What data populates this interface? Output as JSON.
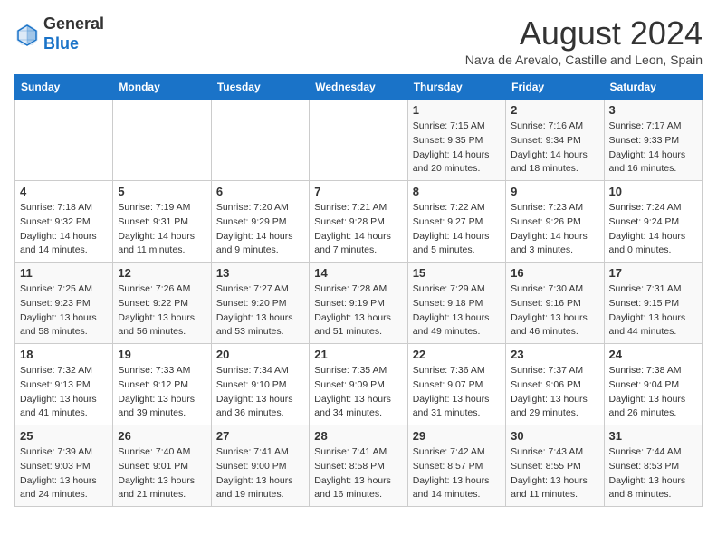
{
  "header": {
    "logo_line1": "General",
    "logo_line2": "Blue",
    "month_year": "August 2024",
    "subtitle": "Nava de Arevalo, Castille and Leon, Spain"
  },
  "weekdays": [
    "Sunday",
    "Monday",
    "Tuesday",
    "Wednesday",
    "Thursday",
    "Friday",
    "Saturday"
  ],
  "weeks": [
    [
      {
        "day": "",
        "detail": ""
      },
      {
        "day": "",
        "detail": ""
      },
      {
        "day": "",
        "detail": ""
      },
      {
        "day": "",
        "detail": ""
      },
      {
        "day": "1",
        "detail": "Sunrise: 7:15 AM\nSunset: 9:35 PM\nDaylight: 14 hours\nand 20 minutes."
      },
      {
        "day": "2",
        "detail": "Sunrise: 7:16 AM\nSunset: 9:34 PM\nDaylight: 14 hours\nand 18 minutes."
      },
      {
        "day": "3",
        "detail": "Sunrise: 7:17 AM\nSunset: 9:33 PM\nDaylight: 14 hours\nand 16 minutes."
      }
    ],
    [
      {
        "day": "4",
        "detail": "Sunrise: 7:18 AM\nSunset: 9:32 PM\nDaylight: 14 hours\nand 14 minutes."
      },
      {
        "day": "5",
        "detail": "Sunrise: 7:19 AM\nSunset: 9:31 PM\nDaylight: 14 hours\nand 11 minutes."
      },
      {
        "day": "6",
        "detail": "Sunrise: 7:20 AM\nSunset: 9:29 PM\nDaylight: 14 hours\nand 9 minutes."
      },
      {
        "day": "7",
        "detail": "Sunrise: 7:21 AM\nSunset: 9:28 PM\nDaylight: 14 hours\nand 7 minutes."
      },
      {
        "day": "8",
        "detail": "Sunrise: 7:22 AM\nSunset: 9:27 PM\nDaylight: 14 hours\nand 5 minutes."
      },
      {
        "day": "9",
        "detail": "Sunrise: 7:23 AM\nSunset: 9:26 PM\nDaylight: 14 hours\nand 3 minutes."
      },
      {
        "day": "10",
        "detail": "Sunrise: 7:24 AM\nSunset: 9:24 PM\nDaylight: 14 hours\nand 0 minutes."
      }
    ],
    [
      {
        "day": "11",
        "detail": "Sunrise: 7:25 AM\nSunset: 9:23 PM\nDaylight: 13 hours\nand 58 minutes."
      },
      {
        "day": "12",
        "detail": "Sunrise: 7:26 AM\nSunset: 9:22 PM\nDaylight: 13 hours\nand 56 minutes."
      },
      {
        "day": "13",
        "detail": "Sunrise: 7:27 AM\nSunset: 9:20 PM\nDaylight: 13 hours\nand 53 minutes."
      },
      {
        "day": "14",
        "detail": "Sunrise: 7:28 AM\nSunset: 9:19 PM\nDaylight: 13 hours\nand 51 minutes."
      },
      {
        "day": "15",
        "detail": "Sunrise: 7:29 AM\nSunset: 9:18 PM\nDaylight: 13 hours\nand 49 minutes."
      },
      {
        "day": "16",
        "detail": "Sunrise: 7:30 AM\nSunset: 9:16 PM\nDaylight: 13 hours\nand 46 minutes."
      },
      {
        "day": "17",
        "detail": "Sunrise: 7:31 AM\nSunset: 9:15 PM\nDaylight: 13 hours\nand 44 minutes."
      }
    ],
    [
      {
        "day": "18",
        "detail": "Sunrise: 7:32 AM\nSunset: 9:13 PM\nDaylight: 13 hours\nand 41 minutes."
      },
      {
        "day": "19",
        "detail": "Sunrise: 7:33 AM\nSunset: 9:12 PM\nDaylight: 13 hours\nand 39 minutes."
      },
      {
        "day": "20",
        "detail": "Sunrise: 7:34 AM\nSunset: 9:10 PM\nDaylight: 13 hours\nand 36 minutes."
      },
      {
        "day": "21",
        "detail": "Sunrise: 7:35 AM\nSunset: 9:09 PM\nDaylight: 13 hours\nand 34 minutes."
      },
      {
        "day": "22",
        "detail": "Sunrise: 7:36 AM\nSunset: 9:07 PM\nDaylight: 13 hours\nand 31 minutes."
      },
      {
        "day": "23",
        "detail": "Sunrise: 7:37 AM\nSunset: 9:06 PM\nDaylight: 13 hours\nand 29 minutes."
      },
      {
        "day": "24",
        "detail": "Sunrise: 7:38 AM\nSunset: 9:04 PM\nDaylight: 13 hours\nand 26 minutes."
      }
    ],
    [
      {
        "day": "25",
        "detail": "Sunrise: 7:39 AM\nSunset: 9:03 PM\nDaylight: 13 hours\nand 24 minutes."
      },
      {
        "day": "26",
        "detail": "Sunrise: 7:40 AM\nSunset: 9:01 PM\nDaylight: 13 hours\nand 21 minutes."
      },
      {
        "day": "27",
        "detail": "Sunrise: 7:41 AM\nSunset: 9:00 PM\nDaylight: 13 hours\nand 19 minutes."
      },
      {
        "day": "28",
        "detail": "Sunrise: 7:41 AM\nSunset: 8:58 PM\nDaylight: 13 hours\nand 16 minutes."
      },
      {
        "day": "29",
        "detail": "Sunrise: 7:42 AM\nSunset: 8:57 PM\nDaylight: 13 hours\nand 14 minutes."
      },
      {
        "day": "30",
        "detail": "Sunrise: 7:43 AM\nSunset: 8:55 PM\nDaylight: 13 hours\nand 11 minutes."
      },
      {
        "day": "31",
        "detail": "Sunrise: 7:44 AM\nSunset: 8:53 PM\nDaylight: 13 hours\nand 8 minutes."
      }
    ]
  ]
}
